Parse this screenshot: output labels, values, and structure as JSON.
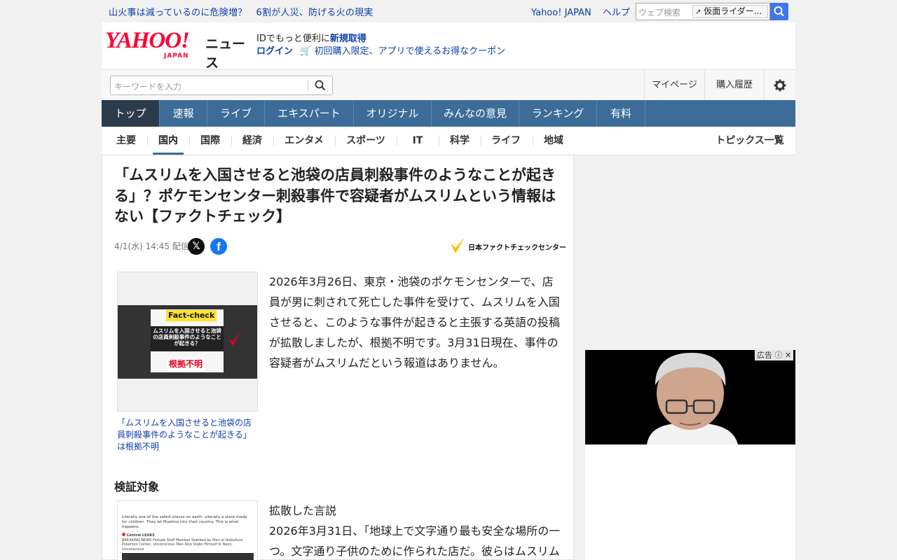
{
  "topbar": {
    "news_ticker": "山火事は減っているのに危険増？　6割が人災、防げる火の現実",
    "links": [
      "Yahoo! JAPAN",
      "ヘルプ"
    ],
    "web_search_placeholder": "ウェブ検索",
    "web_search_chip": "仮面ライダー..."
  },
  "header": {
    "logo_text": "YAHOO!",
    "logo_sub": "JAPAN",
    "service_name": "ニュース",
    "id_prompt": "IDでもっと便利に",
    "signup_link": "新規取得",
    "login_link": "ログイン",
    "coupon_text": "初回購入限定、アプリで使えるお得なクーポン"
  },
  "search": {
    "placeholder": "キーワードを入力",
    "right_links": [
      "マイページ",
      "購入履歴"
    ]
  },
  "main_nav": {
    "tabs": [
      "トップ",
      "速報",
      "ライブ",
      "エキスパート",
      "オリジナル",
      "みんなの意見",
      "ランキング",
      "有料"
    ],
    "active": "トップ"
  },
  "sub_nav": {
    "tabs": [
      "主要",
      "国内",
      "国際",
      "経済",
      "エンタメ",
      "スポーツ",
      "IT",
      "科学",
      "ライフ",
      "地域"
    ],
    "active": "国内",
    "topics_link": "トピックス一覧"
  },
  "article": {
    "headline": "「ムスリムを入国させると池袋の店員刺殺事件のようなことが起きる」？ポケモンセンター刺殺事件で容疑者がムスリムという情報はない【ファクトチェック】",
    "date": "4/1(水) 14:45 配信",
    "source": "日本ファクトチェックセンター",
    "figure1": {
      "badge": "Fact-check",
      "message": "ムスリムを入国させると池袋の店員刺殺事件のようなことが起きる？",
      "verdict": "根拠不明",
      "caption": "「ムスリムを入国させると池袋の店員刺殺事件のようなことが起きる」は根拠不明"
    },
    "lead": "2026年3月26日、東京・池袋のポケモンセンターで、店員が男に刺されて死亡した事件を受けて、ムスリムを入国させると、このような事件が起きると主張する英語の投稿が拡散しましたが、根拠不明です。3月31日現在、事件の容疑者がムスリムだという報道はありません。",
    "section_title": "検証対象",
    "figure2": {
      "post_text": "Literally one of the safest places on earth. Literally a store made for children. They let Muslims into their country. This is what happens.",
      "account": "Central LEAKS",
      "breaking": "BREAKING NEWS Female Staff Member Stabbed by Man at Ikebukuro Pokemon Center, Unconscious Man Also Stabs Himself In Neck, Unconscious"
    },
    "claim_label": "拡散した言説",
    "claim_text": "2026年3月31日、「地球上で文字通り最も安全な場所の一つ。文字通り子供のために作られた店だ。彼らはムスリム"
  },
  "ad": {
    "label": "広告"
  },
  "colors": {
    "brand_red": "#ff0033",
    "nav_blue": "#3c6c97",
    "link_blue": "#0b3faa",
    "search_blue": "#3e78e8"
  }
}
